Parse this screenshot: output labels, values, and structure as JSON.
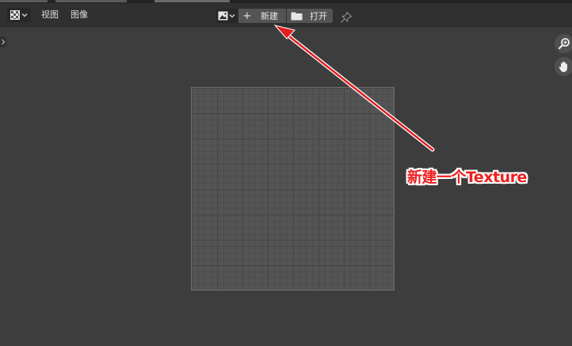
{
  "header": {
    "menus": [
      {
        "label": "视图"
      },
      {
        "label": "图像"
      }
    ],
    "new_button_label": "新建",
    "open_button_label": "打开"
  },
  "annotation": {
    "text": "新建一个Texture",
    "color": "#ee2020"
  },
  "icons": {
    "editor_type": "checkerboard-image-editor-icon",
    "browse": "image-browse-icon",
    "new": "plus-icon",
    "open": "folder-icon",
    "pin": "pin-icon",
    "zoom": "zoom-magnifier-icon",
    "pan": "hand-icon"
  },
  "colors": {
    "background": "#3d3d3d",
    "header": "#303030",
    "button": "#545454",
    "annotation_red": "#ee2020"
  }
}
